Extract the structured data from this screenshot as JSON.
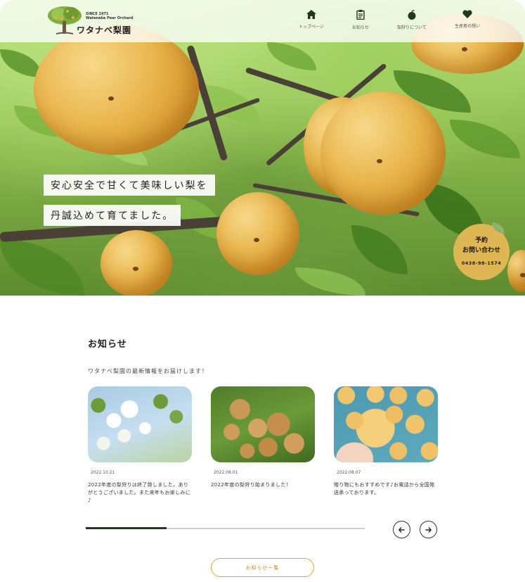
{
  "header": {
    "logo_since": "SINCE 1971",
    "logo_en": "Watanabe Pear Orchard",
    "logo_name": "ワタナベ梨園",
    "nav": [
      {
        "label": "トップページ",
        "icon": "home-icon"
      },
      {
        "label": "お知らせ",
        "icon": "notice-icon"
      },
      {
        "label": "梨狩りについて",
        "icon": "apple-icon"
      },
      {
        "label": "生産者の想い",
        "icon": "heart-icon"
      }
    ],
    "icon_color": "#1e3a17"
  },
  "hero": {
    "catch_line1": "安心安全で甘くて美味しい梨を",
    "catch_line2": "丹誠込めて育てました。"
  },
  "reservation": {
    "line1": "予約",
    "line2": "お問い合わせ",
    "tel": "0438-98-1574",
    "color": "#dfb654"
  },
  "news": {
    "title": "お知らせ",
    "lead": "ワタナベ梨園の最新情報をお届けします！",
    "items": [
      {
        "date": "2022.10.21",
        "text": "2022年度の梨狩りは終了致しました。ありがとうございました。また来年もお楽しみに♪",
        "image": "pear-blossom"
      },
      {
        "date": "2022.08.01",
        "text": "2022年度の梨狩り始まりました！",
        "image": "pears-on-tree"
      },
      {
        "date": "2022.08.07",
        "text": "贈り物にもおすすめです♪お電話から全国発送承っております。",
        "image": "pear-in-hand"
      }
    ],
    "progress": 0.29,
    "prev_icon": "arrow-left-icon",
    "next_icon": "arrow-right-icon",
    "more_label": "お知らせ一覧",
    "accent": "#d9a63a"
  }
}
